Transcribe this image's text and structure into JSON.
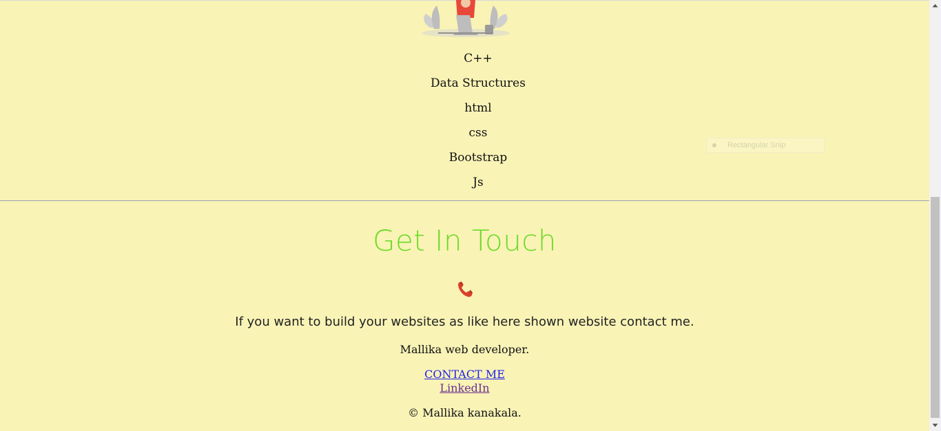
{
  "skills": {
    "items": [
      "C++",
      "Data Structures",
      "html",
      "css",
      "Bootstrap",
      "Js"
    ]
  },
  "overlay": {
    "snip_label": "Rectangular Snip"
  },
  "contact": {
    "title": "Get In Touch",
    "lead": "If you want to build your websites as like here shown website contact me.",
    "subtitle": "Mallika web developer.",
    "contact_link": "CONTACT ME",
    "linkedin_link": "LinkedIn",
    "copyright": "© Mallika kanakala."
  },
  "icons": {
    "phone": "phone-icon",
    "illustration": "person-with-laptop-illustration"
  },
  "colors": {
    "background": "#f9f3b6",
    "title": "#6fdb2a",
    "link": "#1f1fee",
    "visited_link": "#6a2f8f",
    "phone": "#d9402a"
  }
}
